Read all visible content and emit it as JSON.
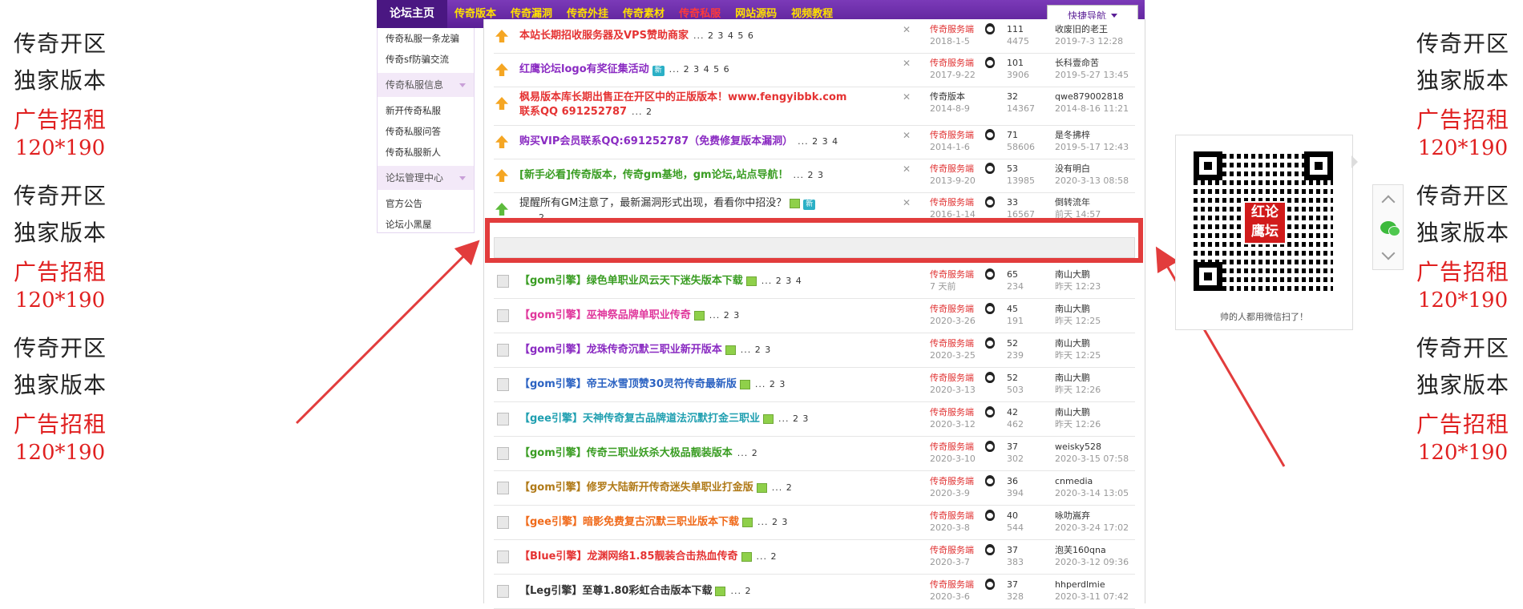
{
  "side_ads": {
    "left": [
      {
        "line1": "传奇开区",
        "line2": "独家版本",
        "line3": "广告招租",
        "line4": "120*190"
      },
      {
        "line1": "传奇开区",
        "line2": "独家版本",
        "line3": "广告招租",
        "line4": "120*190"
      },
      {
        "line1": "传奇开区",
        "line2": "独家版本",
        "line3": "广告招租",
        "line4": "120*190"
      }
    ],
    "right": [
      {
        "line1": "传奇开区",
        "line2": "独家版本",
        "line3": "广告招租",
        "line4": "120*190"
      },
      {
        "line1": "传奇开区",
        "line2": "独家版本",
        "line3": "广告招租",
        "line4": "120*190"
      },
      {
        "line1": "传奇开区",
        "line2": "独家版本",
        "line3": "广告招租",
        "line4": "120*190"
      }
    ]
  },
  "nav": {
    "items": [
      "论坛主页",
      "传奇版本",
      "传奇漏洞",
      "传奇外挂",
      "传奇素材",
      "传奇私服",
      "网站源码",
      "视频教程"
    ],
    "quick_nav": "快捷导航"
  },
  "left_menu": {
    "items_top": [
      "传奇私服一条龙骗",
      "传奇sf防骗交流"
    ],
    "section1": "传奇私服信息",
    "items_mid": [
      "新开传奇私服",
      "传奇私服问答",
      "传奇私服新人"
    ],
    "section2": "论坛管理中心",
    "items_bottom": [
      "官方公告",
      "论坛小黑屋"
    ]
  },
  "threads": [
    {
      "title": "本站长期招收服务器及VPS赞助商家",
      "pages": "... 2 3 4 5 6",
      "author": "传奇服务端",
      "date": "2018-1-5",
      "replies": "111",
      "views": "4475",
      "last_user": "收废旧的老王",
      "last_time": "2019-7-3 12:28"
    },
    {
      "title": "红鹰论坛logo有奖征集活动",
      "tag": "新",
      "pages": "... 2 3 4 5 6",
      "author": "传奇服务端",
      "date": "2017-9-22",
      "replies": "101",
      "views": "3906",
      "last_user": "长科壹命苦",
      "last_time": "2019-5-27 13:45"
    },
    {
      "title": "枫易版本库长期出售正在开区中的正版版本！www.fengyibbk.com",
      "title2": "联系QQ 691252787",
      "pages": "... 2",
      "author": "传奇版本",
      "date": "2014-8-9",
      "replies": "32",
      "views": "14367",
      "last_user": "qwe879002818",
      "last_time": "2014-8-16 11:21"
    },
    {
      "title": "购买VIP会员联系QQ:691252787（免费修复版本漏洞）",
      "pages": "... 2 3 4",
      "author": "传奇服务端",
      "date": "2014-1-6",
      "replies": "71",
      "views": "58606",
      "last_user": "是冬拂梓",
      "last_time": "2019-5-17 12:43"
    },
    {
      "title": "[新手必看]传奇版本，传奇gm基地，gm论坛,站点导航！",
      "pages": "... 2 3",
      "author": "传奇服务端",
      "date": "2013-9-20",
      "replies": "53",
      "views": "13985",
      "last_user": "没有明白",
      "last_time": "2020-3-13 08:58"
    },
    {
      "title": "提醒所有GM注意了，最新漏洞形式出现，看看你中招没？",
      "tag": "新",
      "title2": "... 2",
      "author": "传奇服务端",
      "date": "2016-1-14",
      "replies": "33",
      "views": "16567",
      "last_user": "倒转流年",
      "last_time": "前天 14:57"
    },
    {
      "title": "【gom引擎】绿色单职业风云天下迷失版本下载",
      "pages": "... 2 3 4",
      "author": "传奇服务端",
      "date": "7 天前",
      "replies": "65",
      "views": "234",
      "last_user": "南山大鹏",
      "last_time": "昨天 12:23"
    },
    {
      "title": "【gom引擎】巫神祭品牌单职业传奇",
      "pages": "... 2 3",
      "author": "传奇服务端",
      "date": "2020-3-26",
      "replies": "45",
      "views": "191",
      "last_user": "南山大鹏",
      "last_time": "昨天 12:25"
    },
    {
      "title": "【gom引擎】龙珠传奇沉默三职业新开版本",
      "pages": "... 2 3",
      "author": "传奇服务端",
      "date": "2020-3-25",
      "replies": "52",
      "views": "239",
      "last_user": "南山大鹏",
      "last_time": "昨天 12:25"
    },
    {
      "title": "【gom引擎】帝王冰雪顶赞30灵符传奇最新版",
      "pages": "... 2 3",
      "author": "传奇服务端",
      "date": "2020-3-13",
      "replies": "52",
      "views": "503",
      "last_user": "南山大鹏",
      "last_time": "昨天 12:26"
    },
    {
      "title": "【gee引擎】天神传奇复古品牌道法沉默打金三职业",
      "pages": "... 2 3",
      "author": "传奇服务端",
      "date": "2020-3-12",
      "replies": "42",
      "views": "462",
      "last_user": "南山大鹏",
      "last_time": "昨天 12:26"
    },
    {
      "title": "【gom引擎】传奇三职业妖杀大极品靓装版本",
      "pages": "... 2",
      "author": "传奇服务端",
      "date": "2020-3-10",
      "replies": "37",
      "views": "302",
      "last_user": "weisky528",
      "last_time": "2020-3-15 07:58"
    },
    {
      "title": "【gom引擎】修罗大陆新开传奇迷失单职业打金版",
      "pages": "... 2",
      "author": "传奇服务端",
      "date": "2020-3-9",
      "replies": "36",
      "views": "394",
      "last_user": "cnmedia",
      "last_time": "2020-3-14 13:05"
    },
    {
      "title": "【gee引擎】暗影免费复古沉默三职业版本下载",
      "pages": "... 2 3",
      "author": "传奇服务端",
      "date": "2020-3-8",
      "replies": "40",
      "views": "544",
      "last_user": "咏叻嵩弃",
      "last_time": "2020-3-24 17:02"
    },
    {
      "title": "【Blue引擎】龙渊网络1.85靓装合击热血传奇",
      "pages": "... 2",
      "author": "传奇服务端",
      "date": "2020-3-7",
      "replies": "37",
      "views": "383",
      "last_user": "泡芙160qna",
      "last_time": "2020-3-12 09:36"
    },
    {
      "title": "【Leg引擎】至尊1.80彩虹合击版本下载",
      "pages": "... 2",
      "author": "传奇服务端",
      "date": "2020-3-6",
      "replies": "37",
      "views": "328",
      "last_user": "hhperdlmie",
      "last_time": "2020-3-11 07:42"
    }
  ],
  "qr": {
    "logo_text": "红论鹰坛",
    "caption": "帅的人都用微信扫了！"
  },
  "colors": {
    "accent_purple": "#5a1f96",
    "highlight_red": "#e23c3c"
  }
}
